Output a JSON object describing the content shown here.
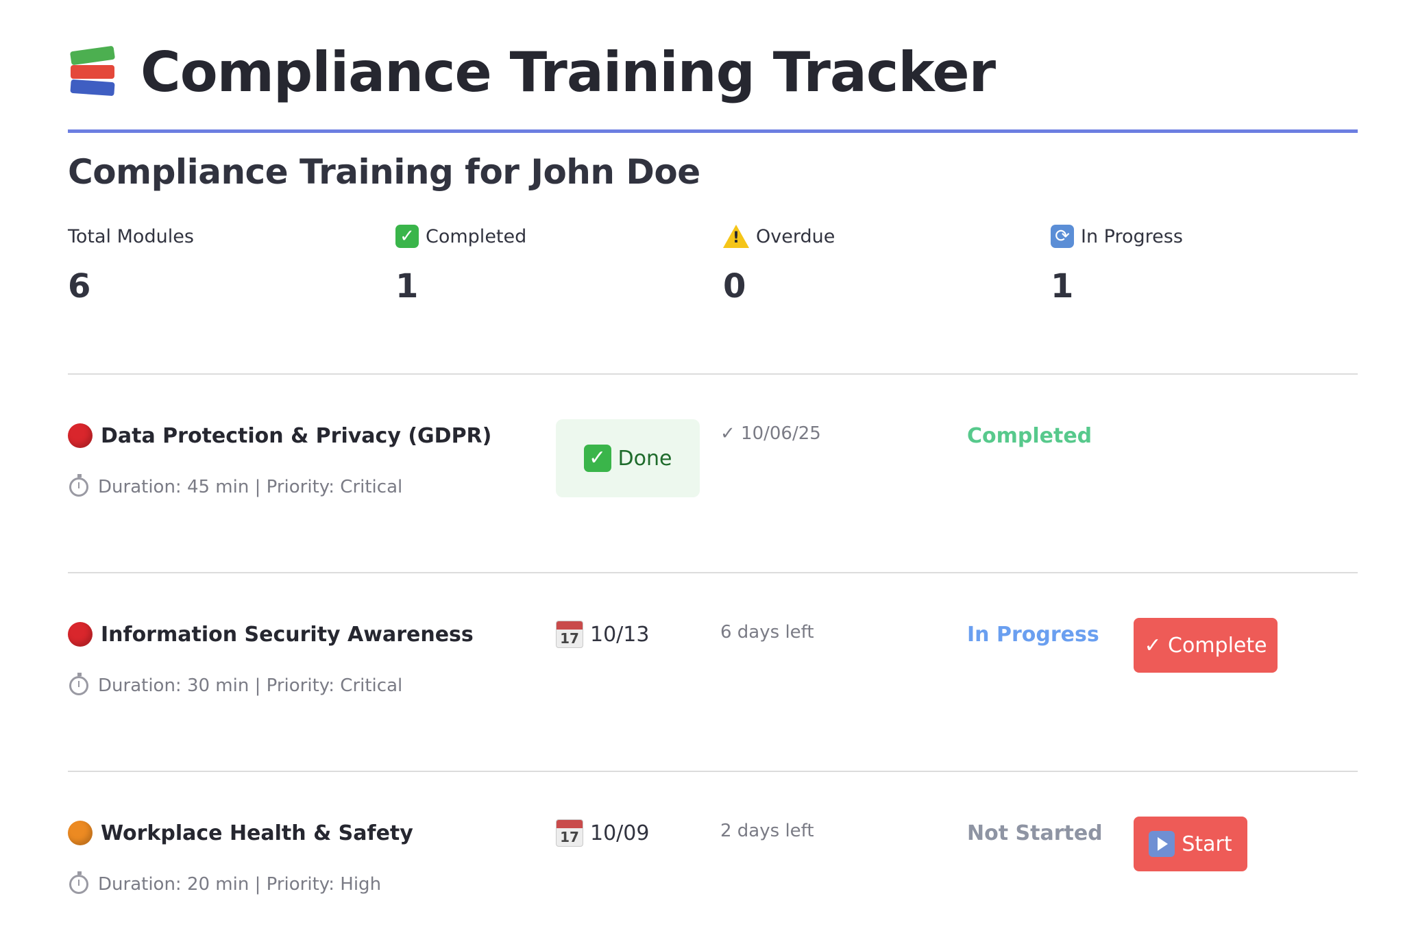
{
  "title": "Compliance Training Tracker",
  "title_icon": "books-icon",
  "accent_color": "#6c7ee1",
  "subtitle": "Compliance Training for John Doe",
  "metrics": [
    {
      "label": "Total Modules",
      "value": "6",
      "icon": ""
    },
    {
      "label": "Completed",
      "value": "1",
      "icon": "check-mark-icon"
    },
    {
      "label": "Overdue",
      "value": "0",
      "icon": "warning-icon"
    },
    {
      "label": "In Progress",
      "value": "1",
      "icon": "cycle-arrows-icon"
    }
  ],
  "modules": [
    {
      "name": "Data Protection & Privacy (GDPR)",
      "priority_dot_color": "#d9262c",
      "meta": "Duration: 45 min | Priority: Critical",
      "done_label": "Done",
      "completed_date": "✓ 10/06/25",
      "status": "Completed",
      "status_color": "#57c98c"
    },
    {
      "name": "Information Security Awareness",
      "priority_dot_color": "#d9262c",
      "meta": "Duration: 30 min | Priority: Critical",
      "due_date": "10/13",
      "calendar_day": "17",
      "days_left": "6 days left",
      "status": "In Progress",
      "status_color": "#6a9ff0",
      "action_label": "✓ Complete"
    },
    {
      "name": "Workplace Health & Safety",
      "priority_dot_color": "#ec8a22",
      "meta": "Duration: 20 min | Priority: High",
      "due_date": "10/09",
      "calendar_day": "17",
      "days_left": "2 days left",
      "status": "Not Started",
      "status_color": "#8e94a3",
      "action_label": "Start"
    }
  ]
}
